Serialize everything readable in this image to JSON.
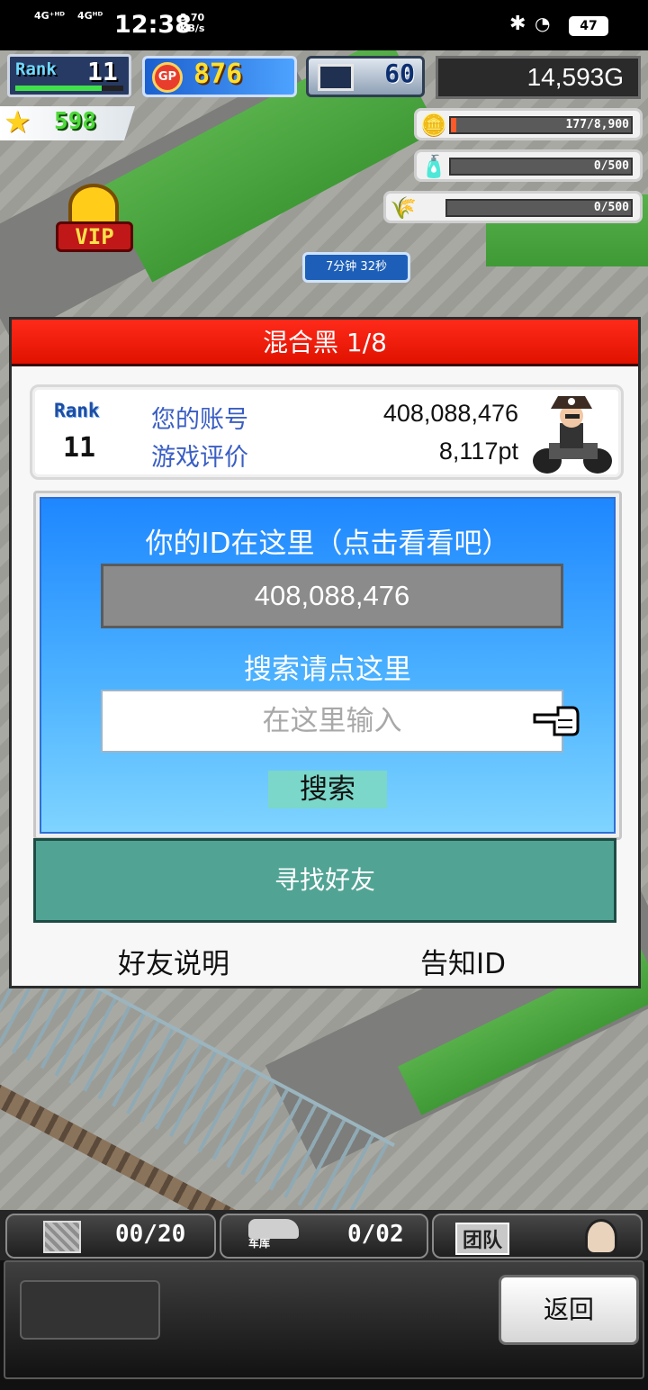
{
  "status_bar": {
    "network_1": "4G⁺ᴴᴰ",
    "network_2": "4Gᴴᴰ",
    "time": "12:38",
    "speed_value": "3.70",
    "speed_unit": "KB/s",
    "battery": "47"
  },
  "hud": {
    "rank_label": "Rank",
    "rank_value": "11",
    "rank_progress": 0.8,
    "gp_label": "GP",
    "gp_value": "876",
    "pc_value": "60",
    "money": "14,593G",
    "star_value": "598",
    "resources": [
      {
        "icon": "coin-stack-icon",
        "text": "177/8,900",
        "fill": 0.02
      },
      {
        "icon": "bottle-icon",
        "text": "0/500",
        "fill": 0
      },
      {
        "icon": "wheat-icon",
        "text": "0/500",
        "fill": 0
      }
    ],
    "vip_label": "VIP",
    "timer": "7分钟 32秒"
  },
  "dialog": {
    "title": "混合黑 1/8",
    "account": {
      "rank_label": "Rank",
      "rank_value": "11",
      "id_label": "您的账号",
      "id_value": "408,088,476",
      "rating_label": "游戏评价",
      "rating_value": "8,117pt"
    },
    "id_heading": "你的ID在这里（点击看看吧）",
    "id_value": "408,088,476",
    "search_heading": "搜索请点这里",
    "search_placeholder": "在这里输入",
    "search_button": "搜索",
    "find_friends_button": "寻找好友",
    "friend_help_link": "好友说明",
    "share_id_link": "告知ID"
  },
  "bottom_bar": {
    "storage_value": "00/20",
    "garage_label": "车库",
    "garage_value": "0/02",
    "team_label": "团队",
    "back_button": "返回"
  }
}
